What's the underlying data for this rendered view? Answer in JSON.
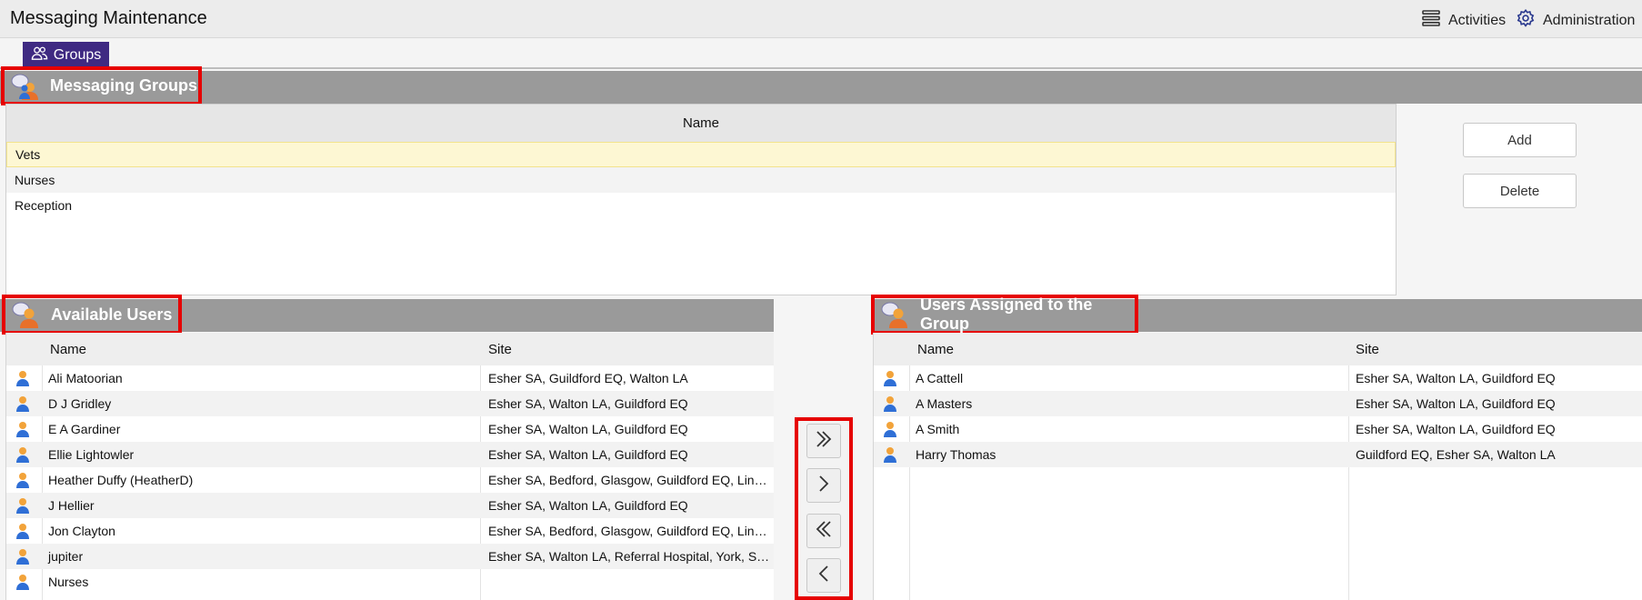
{
  "app": {
    "title": "Messaging Maintenance",
    "activities_label": "Activities",
    "activities_icon": "list-icon",
    "administration_label": "Administration",
    "administration_icon": "gear-icon"
  },
  "tabs": [
    {
      "label": "Groups",
      "icon": "users-icon",
      "active": true
    }
  ],
  "messaging_groups": {
    "title": "Messaging Groups",
    "column": "Name",
    "rows": [
      "Vets",
      "Nurses",
      "Reception"
    ],
    "selected": "Vets",
    "add_label": "Add",
    "delete_label": "Delete"
  },
  "available_users": {
    "title": "Available Users",
    "columns": {
      "name": "Name",
      "site": "Site"
    },
    "rows": [
      {
        "name": "Ali Matoorian",
        "site": "Esher SA, Guildford EQ, Walton LA"
      },
      {
        "name": "D J Gridley",
        "site": "Esher SA, Walton LA, Guildford EQ"
      },
      {
        "name": "E A Gardiner",
        "site": "Esher SA, Walton LA, Guildford EQ"
      },
      {
        "name": "Ellie Lightowler",
        "site": "Esher SA, Walton LA, Guildford EQ"
      },
      {
        "name": "Heather Duffy (HeatherD)",
        "site": "Esher SA, Bedford, Glasgow, Guildford EQ, Linc..."
      },
      {
        "name": "J Hellier",
        "site": "Esher SA, Walton LA, Guildford EQ"
      },
      {
        "name": "Jon Clayton",
        "site": "Esher SA, Bedford, Glasgow, Guildford EQ, Linc..."
      },
      {
        "name": "jupiter",
        "site": "Esher SA, Walton LA, Referral Hospital, York, Shr..."
      },
      {
        "name": "Nurses",
        "site": ""
      }
    ]
  },
  "assigned_users": {
    "title": "Users Assigned to the Group",
    "columns": {
      "name": "Name",
      "site": "Site"
    },
    "rows": [
      {
        "name": "A Cattell",
        "site": "Esher SA, Walton LA, Guildford EQ"
      },
      {
        "name": "A Masters",
        "site": "Esher SA, Walton LA, Guildford EQ"
      },
      {
        "name": "A Smith",
        "site": "Esher SA, Walton LA, Guildford EQ"
      },
      {
        "name": "Harry Thomas",
        "site": "Guildford EQ, Esher SA, Walton LA"
      }
    ]
  },
  "transfer_buttons": [
    {
      "action": "add-all",
      "icon": "double-chevron-right-icon"
    },
    {
      "action": "add-selected",
      "icon": "chevron-right-icon"
    },
    {
      "action": "remove-all",
      "icon": "double-chevron-left-icon"
    },
    {
      "action": "remove-selected",
      "icon": "chevron-left-icon"
    }
  ],
  "colors": {
    "tab_active": "#3f2a82",
    "section_header": "#9a9a9a",
    "highlight_border": "#e60000",
    "selected_row": "#fdf7d3"
  }
}
